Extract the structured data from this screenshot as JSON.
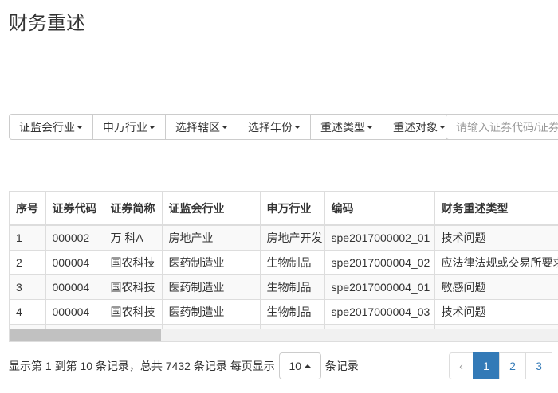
{
  "title": "财务重述",
  "toolbar": {
    "filters": [
      "证监会行业",
      "申万行业",
      "选择辖区",
      "选择年份",
      "重述类型",
      "重述对象"
    ],
    "search_placeholder": "请输入证券代码/证券简称"
  },
  "table": {
    "headers": [
      "序号",
      "证券代码",
      "证券简称",
      "证监会行业",
      "申万行业",
      "编码",
      "财务重述类型"
    ],
    "rows": [
      [
        "1",
        "000002",
        "万 科A",
        "房地产业",
        "房地产开发",
        "spe2017000002_01",
        "技术问题"
      ],
      [
        "2",
        "000004",
        "国农科技",
        "医药制造业",
        "生物制品",
        "spe2017000004_02",
        "应法律法规或交易所要求"
      ],
      [
        "3",
        "000004",
        "国农科技",
        "医药制造业",
        "生物制品",
        "spe2017000004_01",
        "敏感问题"
      ],
      [
        "4",
        "000004",
        "国农科技",
        "医药制造业",
        "生物制品",
        "spe2017000004_03",
        "技术问题"
      ]
    ]
  },
  "footer": {
    "summary": "显示第 1 到第 10 条记录，总共 7432 条记录 每页显示",
    "page_size": "10",
    "suffix": "条记录"
  },
  "pager": {
    "prev": "‹",
    "pages": [
      "1",
      "2",
      "3"
    ],
    "active": "1"
  }
}
